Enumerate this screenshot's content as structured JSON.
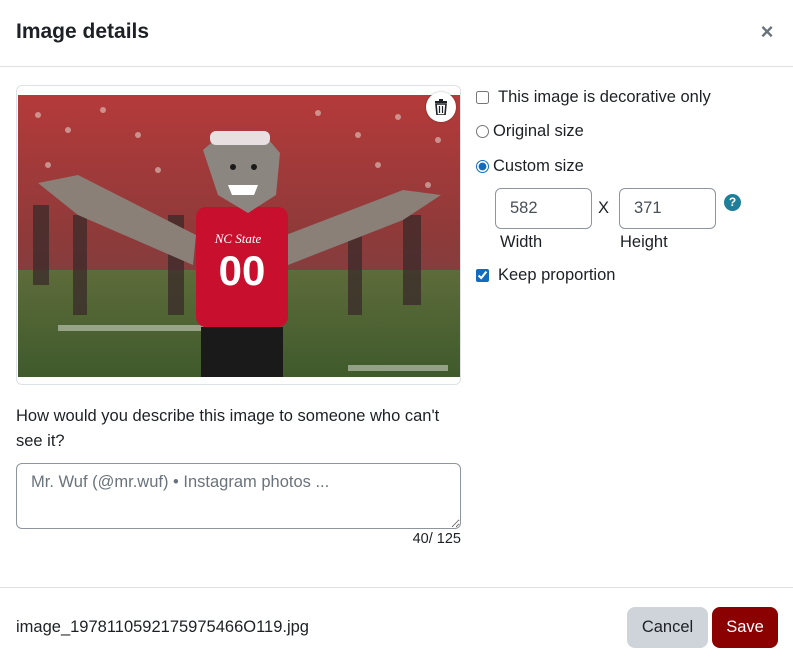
{
  "modal": {
    "title": "Image details",
    "close_label": "×"
  },
  "preview": {
    "image_alt": "Mascot in red 00 jersey with arms outstretched on a football field",
    "jersey_text": "00",
    "delete_icon": "trash-icon"
  },
  "alt_text": {
    "question": "How would you describe this image to someone who can't see it?",
    "value": "",
    "placeholder": "Mr. Wuf (@mr.wuf) • Instagram photos ...",
    "char_count": "40/ 125"
  },
  "options": {
    "decorative_label": "This image is decorative only",
    "decorative_checked": false,
    "original_size_label": "Original size",
    "custom_size_label": "Custom size",
    "selected_size": "custom",
    "width_value": "582",
    "height_value": "371",
    "times_symbol": "X",
    "width_label": "Width",
    "height_label": "Height",
    "help_symbol": "?",
    "keep_proportion_label": "Keep proportion",
    "keep_proportion_checked": true
  },
  "footer": {
    "filename": "image_1978110592175975466O119.jpg",
    "cancel_label": "Cancel",
    "save_label": "Save"
  },
  "colors": {
    "save_bg": "#8b0000",
    "cancel_bg": "#ced4da",
    "accent": "#0f6cbf",
    "help_bg": "#1f7e9a"
  }
}
